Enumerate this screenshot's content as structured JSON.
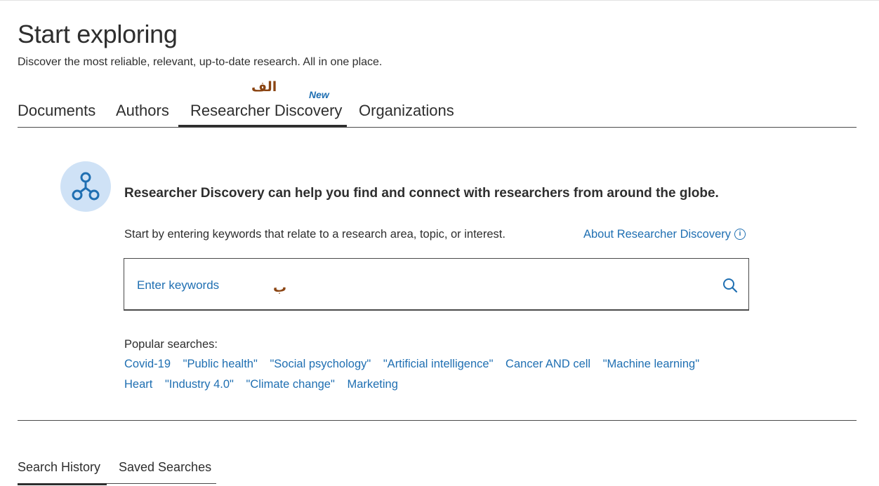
{
  "header": {
    "title": "Start exploring",
    "subtitle": "Discover the most reliable, relevant, up-to-date research. All in one place."
  },
  "annotations": {
    "alef": "الف",
    "be": "ب"
  },
  "tabs": [
    {
      "label": "Documents",
      "active": false
    },
    {
      "label": "Authors",
      "active": false
    },
    {
      "label": "Researcher Discovery",
      "active": true,
      "badge": "New"
    },
    {
      "label": "Organizations",
      "active": false
    }
  ],
  "discovery": {
    "icon": "network-nodes-icon",
    "headline": "Researcher Discovery can help you find and connect with researchers from around the globe.",
    "instructions": "Start by entering keywords that relate to a research area, topic, or interest.",
    "about_link": "About Researcher Discovery",
    "search_placeholder": "Enter keywords",
    "search_value": ""
  },
  "popular": {
    "label": "Popular searches:",
    "row1": [
      "Covid-19",
      "\"Public health\"",
      "\"Social psychology\"",
      "\"Artificial intelligence\"",
      "Cancer AND cell",
      "\"Machine learning\""
    ],
    "row2": [
      "Heart",
      "\"Industry 4.0\"",
      "\"Climate change\"",
      "Marketing"
    ]
  },
  "bottom_tabs": [
    {
      "label": "Search History",
      "active": true
    },
    {
      "label": "Saved Searches",
      "active": false
    }
  ],
  "colors": {
    "link": "#1f6fb2",
    "text": "#2e2e2e",
    "icon_bg": "#cfe2f6",
    "annotation": "#8b4513"
  }
}
